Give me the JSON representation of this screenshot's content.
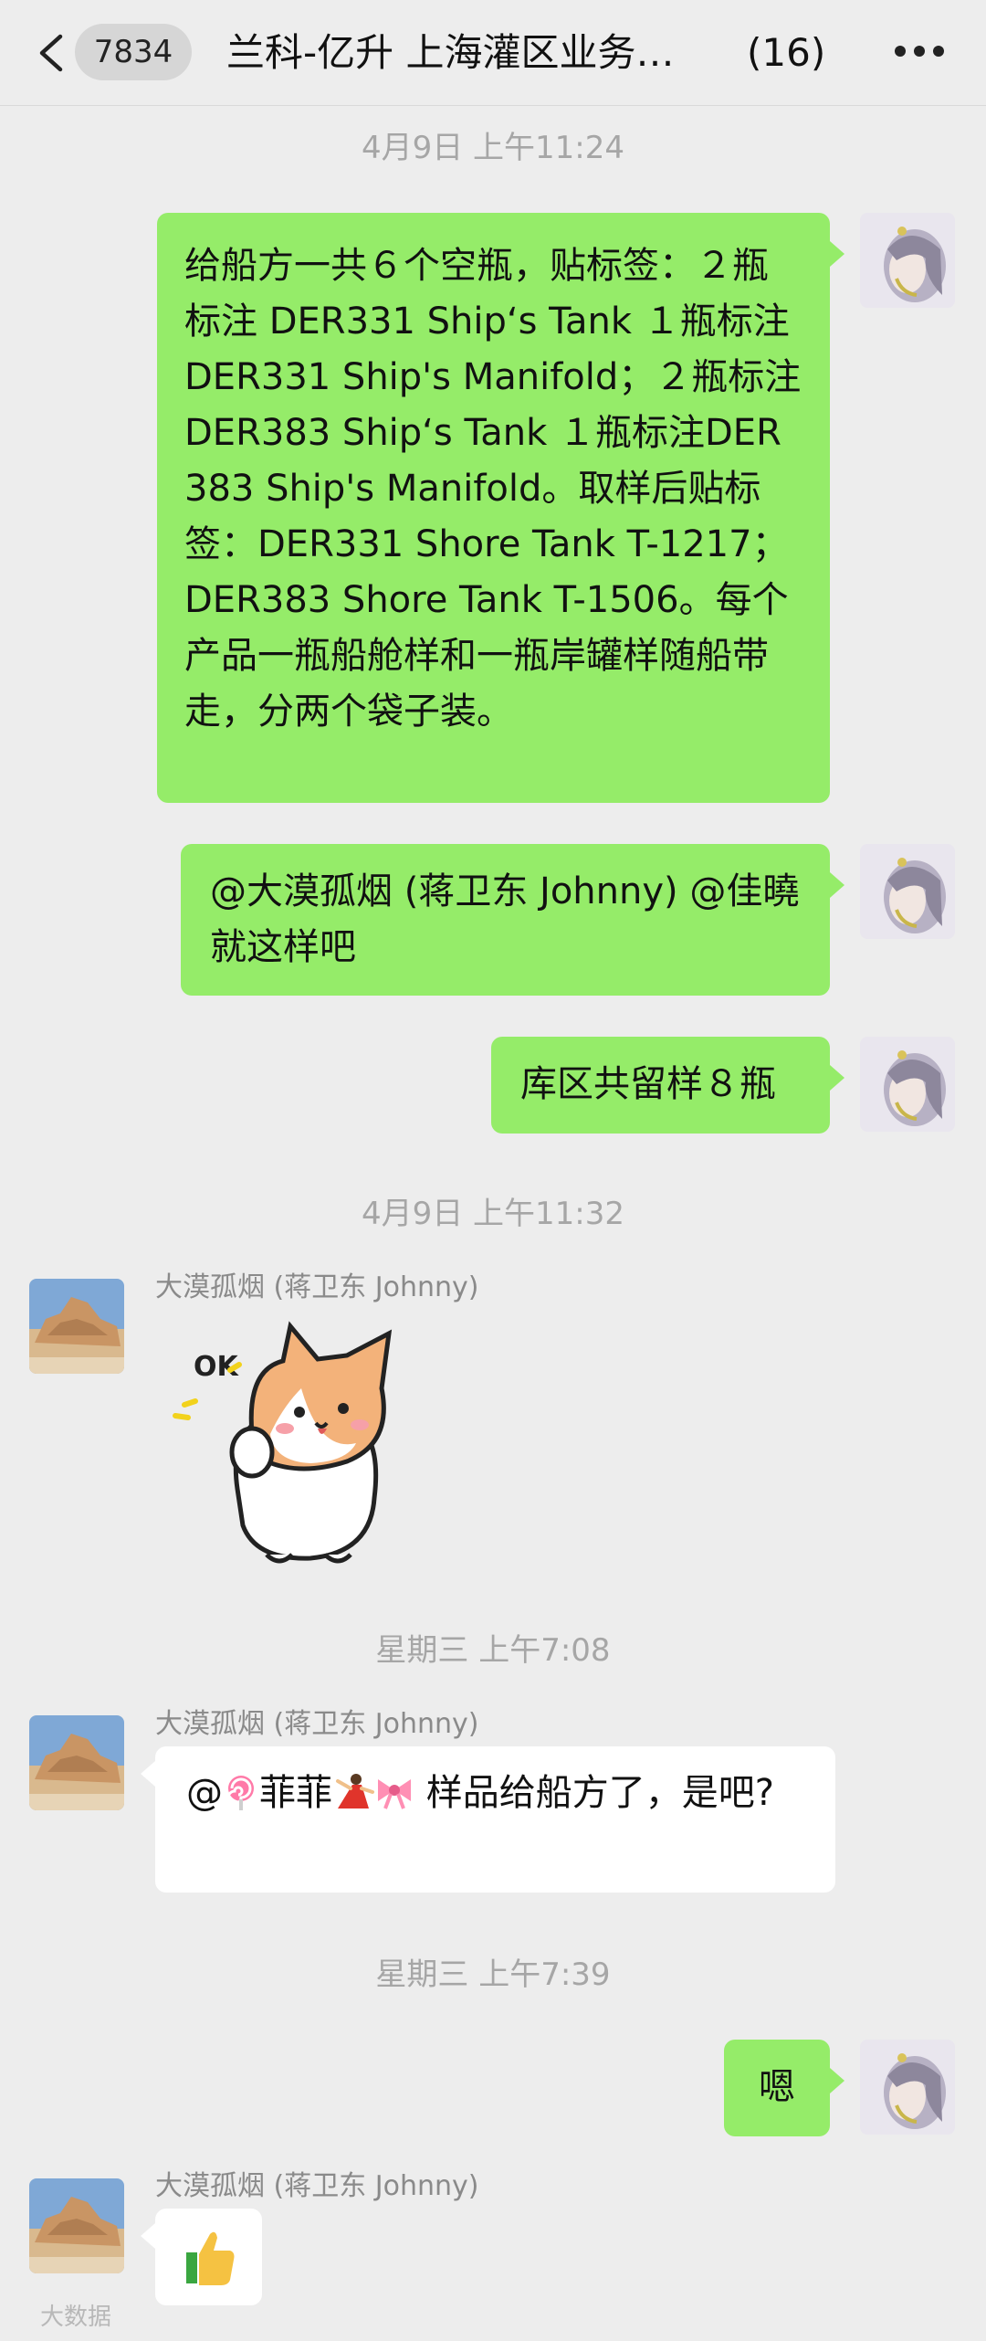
{
  "header": {
    "unread_count": "7834",
    "title": "兰科-亿升 上海灌区业务…",
    "member_count": "(16)"
  },
  "messages": [
    {
      "type": "time",
      "text": "4月9日 上午11:24"
    },
    {
      "type": "out",
      "text": "给船方一共６个空瓶，贴标签：２瓶标注 DER331 Ship‘s Tank １瓶标注DER331 Ship's Manifold；２瓶标注 DER383 Ship‘s Tank １瓶标注DER383 Ship's Manifold。取样后贴标签：DER331 Shore Tank T-1217；DER383 Shore Tank T-1506。每个产品一瓶船舱样和一瓶岸罐样随船带走，分两个袋子装。"
    },
    {
      "type": "out",
      "text": "@大漠孤烟 (蒋卫东 Johnny) @佳曉 就这样吧"
    },
    {
      "type": "out",
      "text": "库区共留样８瓶"
    },
    {
      "type": "time",
      "text": "4月9日 上午11:32"
    },
    {
      "type": "in",
      "sender": "大漠孤烟 (蒋卫东 Johnny)",
      "sticker_text": "OK"
    },
    {
      "type": "time",
      "text": "星期三 上午7:08"
    },
    {
      "type": "in",
      "sender": "大漠孤烟 (蒋卫东 Johnny)",
      "text_prefix": "@",
      "text_name": "菲菲",
      "text_body": "样品给船方了，是吧?"
    },
    {
      "type": "time",
      "text": "星期三 上午7:39"
    },
    {
      "type": "out",
      "text": "嗯"
    },
    {
      "type": "in",
      "sender": "大漠孤烟 (蒋卫东 Johnny)",
      "emoji": "👍"
    }
  ],
  "watermark": "大数据"
}
